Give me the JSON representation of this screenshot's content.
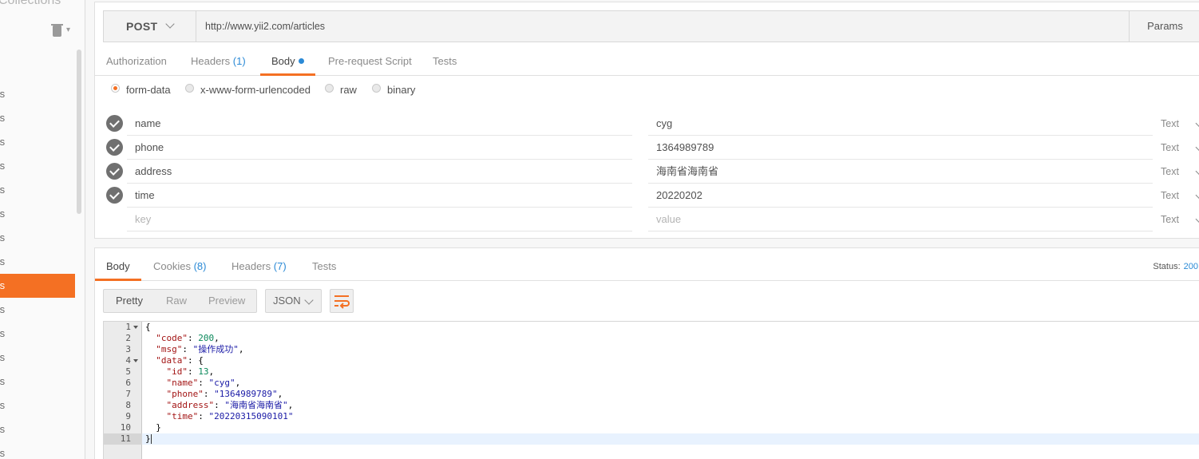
{
  "sidebar": {
    "title": "Collections",
    "items": [
      {
        "label": "cles"
      },
      {
        "label": "cles"
      },
      {
        "label": "cles"
      },
      {
        "label": "cles"
      },
      {
        "label": "cles"
      },
      {
        "label": "cles"
      },
      {
        "label": "cles"
      },
      {
        "label": "cles"
      },
      {
        "label": "cles",
        "active": true
      },
      {
        "label": "cles"
      },
      {
        "label": "cles"
      },
      {
        "label": "cles"
      },
      {
        "label": "cles"
      },
      {
        "label": "cles"
      },
      {
        "label": "cles"
      },
      {
        "label": "cles"
      }
    ]
  },
  "request": {
    "method": "POST",
    "url": "http://www.yii2.com/articles",
    "params_label": "Params",
    "tabs": {
      "authorization": "Authorization",
      "headers": "Headers",
      "headers_count": "(1)",
      "body": "Body",
      "prerequest": "Pre-request Script",
      "tests": "Tests"
    },
    "body_types": {
      "form_data": "form-data",
      "urlencoded": "x-www-form-urlencoded",
      "raw": "raw",
      "binary": "binary"
    },
    "form": [
      {
        "key": "name",
        "value": "cyg",
        "type": "Text"
      },
      {
        "key": "phone",
        "value": "1364989789",
        "type": "Text"
      },
      {
        "key": "address",
        "value": "海南省海南省",
        "type": "Text"
      },
      {
        "key": "time",
        "value": "20220202",
        "type": "Text"
      }
    ],
    "new_row": {
      "key_placeholder": "key",
      "value_placeholder": "value",
      "type": "Text"
    }
  },
  "response": {
    "tabs": {
      "body": "Body",
      "cookies": "Cookies",
      "cookies_count": "(8)",
      "headers": "Headers",
      "headers_count": "(7)",
      "tests": "Tests"
    },
    "status_label": "Status:",
    "status_code": "200",
    "format": {
      "pretty": "Pretty",
      "raw": "Raw",
      "preview": "Preview"
    },
    "language": "JSON",
    "line_numbers": [
      "1",
      "2",
      "3",
      "4",
      "5",
      "6",
      "7",
      "8",
      "9",
      "10",
      "11"
    ],
    "lines": [
      "{",
      "  \"code\": 200,",
      "  \"msg\": \"操作成功\",",
      "  \"data\": {",
      "    \"id\": 13,",
      "    \"name\": \"cyg\",",
      "    \"phone\": \"1364989789\",",
      "    \"address\": \"海南省海南省\",",
      "    \"time\": \"20220315090101\"",
      "  }",
      "}"
    ]
  },
  "colors": {
    "accent": "#f47023",
    "link_blue": "#2b8ad6"
  }
}
